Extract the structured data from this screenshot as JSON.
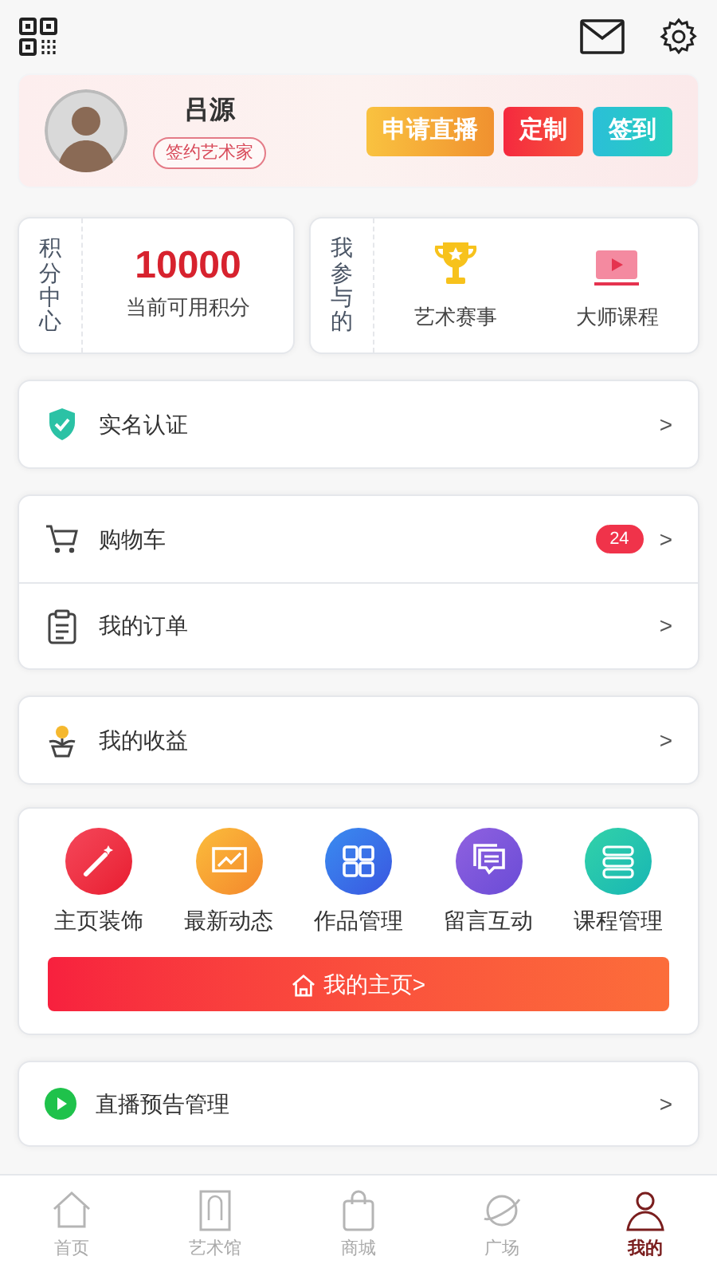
{
  "profile": {
    "name": "吕源",
    "badge": "签约艺术家",
    "buttons": [
      {
        "label": "申请直播",
        "kind": "live"
      },
      {
        "label": "定制",
        "kind": "custom"
      },
      {
        "label": "签到",
        "kind": "checkin"
      }
    ]
  },
  "points": {
    "side_label": "积分中心",
    "value": "10000",
    "caption": "当前可用积分"
  },
  "participation": {
    "side_label": "我参与的",
    "items": [
      {
        "label": "艺术赛事",
        "kind": "trophy"
      },
      {
        "label": "大师课程",
        "kind": "video"
      }
    ]
  },
  "menu_groups": [
    [
      {
        "label": "实名认证",
        "kind": "verify",
        "arrow": ">"
      }
    ],
    [
      {
        "label": "购物车",
        "kind": "cart",
        "count": "24",
        "arrow": ">"
      },
      {
        "label": "我的订单",
        "kind": "orders",
        "arrow": ">"
      }
    ],
    [
      {
        "label": "我的收益",
        "kind": "income",
        "arrow": ">"
      }
    ]
  ],
  "tools": {
    "items": [
      {
        "label": "主页装饰",
        "kind": "wand"
      },
      {
        "label": "最新动态",
        "kind": "chart"
      },
      {
        "label": "作品管理",
        "kind": "grid"
      },
      {
        "label": "留言互动",
        "kind": "chat"
      },
      {
        "label": "课程管理",
        "kind": "books"
      }
    ],
    "home_button": "我的主页>"
  },
  "live_notice": {
    "label": "直播预告管理",
    "arrow": ">"
  },
  "tab_bar": [
    {
      "label": "首页",
      "kind": "home",
      "selected": false
    },
    {
      "label": "艺术馆",
      "kind": "gallery",
      "selected": false
    },
    {
      "label": "商城",
      "kind": "shop",
      "selected": false
    },
    {
      "label": "广场",
      "kind": "planet",
      "selected": false
    },
    {
      "label": "我的",
      "kind": "me",
      "selected": true
    }
  ]
}
